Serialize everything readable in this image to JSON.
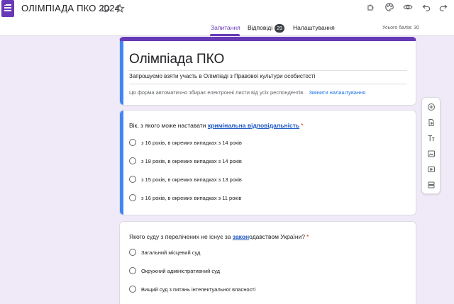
{
  "app": {
    "title": "ОЛІМПІАДА ПКО 2024"
  },
  "icons": {
    "form": "forms-icon",
    "addon": "addon-icon",
    "star": "star-icon",
    "puzzle": "extensions-icon",
    "palette": "palette-icon",
    "preview": "eye-icon",
    "undo": "undo-icon",
    "redo": "redo-icon"
  },
  "tabs": [
    {
      "label": "Запитання",
      "active": true
    },
    {
      "label": "Відповіді",
      "count": "29"
    },
    {
      "label": "Налаштування"
    }
  ],
  "points_total": "Усього балів: 30",
  "form": {
    "title": "Олімпіада ПКО",
    "description": "Запрошуємо взяти участь в Олімпіаді з Правової культури особистості",
    "email_note": "Ця форма автоматично збирає електронні листи від усіх респондентів.",
    "email_link": "Змінити налаштування"
  },
  "questions": [
    {
      "text_before": "Вік, з якого може наставати ",
      "text_highlight": "кримінальна відповідальність",
      "text_after": "",
      "required": "*",
      "options": [
        "з 16 років, в окремих випадках з 14 років",
        "з 18 років, в окремих випадках з 14 років",
        "з 15 років, в окремих випадках з 13 років",
        "з 16 років, в окремих випадках з 11 років"
      ]
    },
    {
      "text_before": "Якого суду з перелічених не існує за ",
      "text_highlight": "закон",
      "text_after": "одавством України?",
      "required": "*",
      "options": [
        "Загальний місцевий суд",
        "Окружний адміністративний суд",
        "Вищий суд з питань інтелектуальної власності"
      ]
    }
  ],
  "side_tools": [
    "add-question-icon",
    "import-questions-icon",
    "add-title-icon",
    "add-image-icon",
    "add-video-icon",
    "add-section-icon"
  ],
  "colors": {
    "accent": "#673ab7",
    "focus": "#4285f4",
    "background": "#efe9f8",
    "link": "#1a73e8",
    "required": "#d93025"
  }
}
